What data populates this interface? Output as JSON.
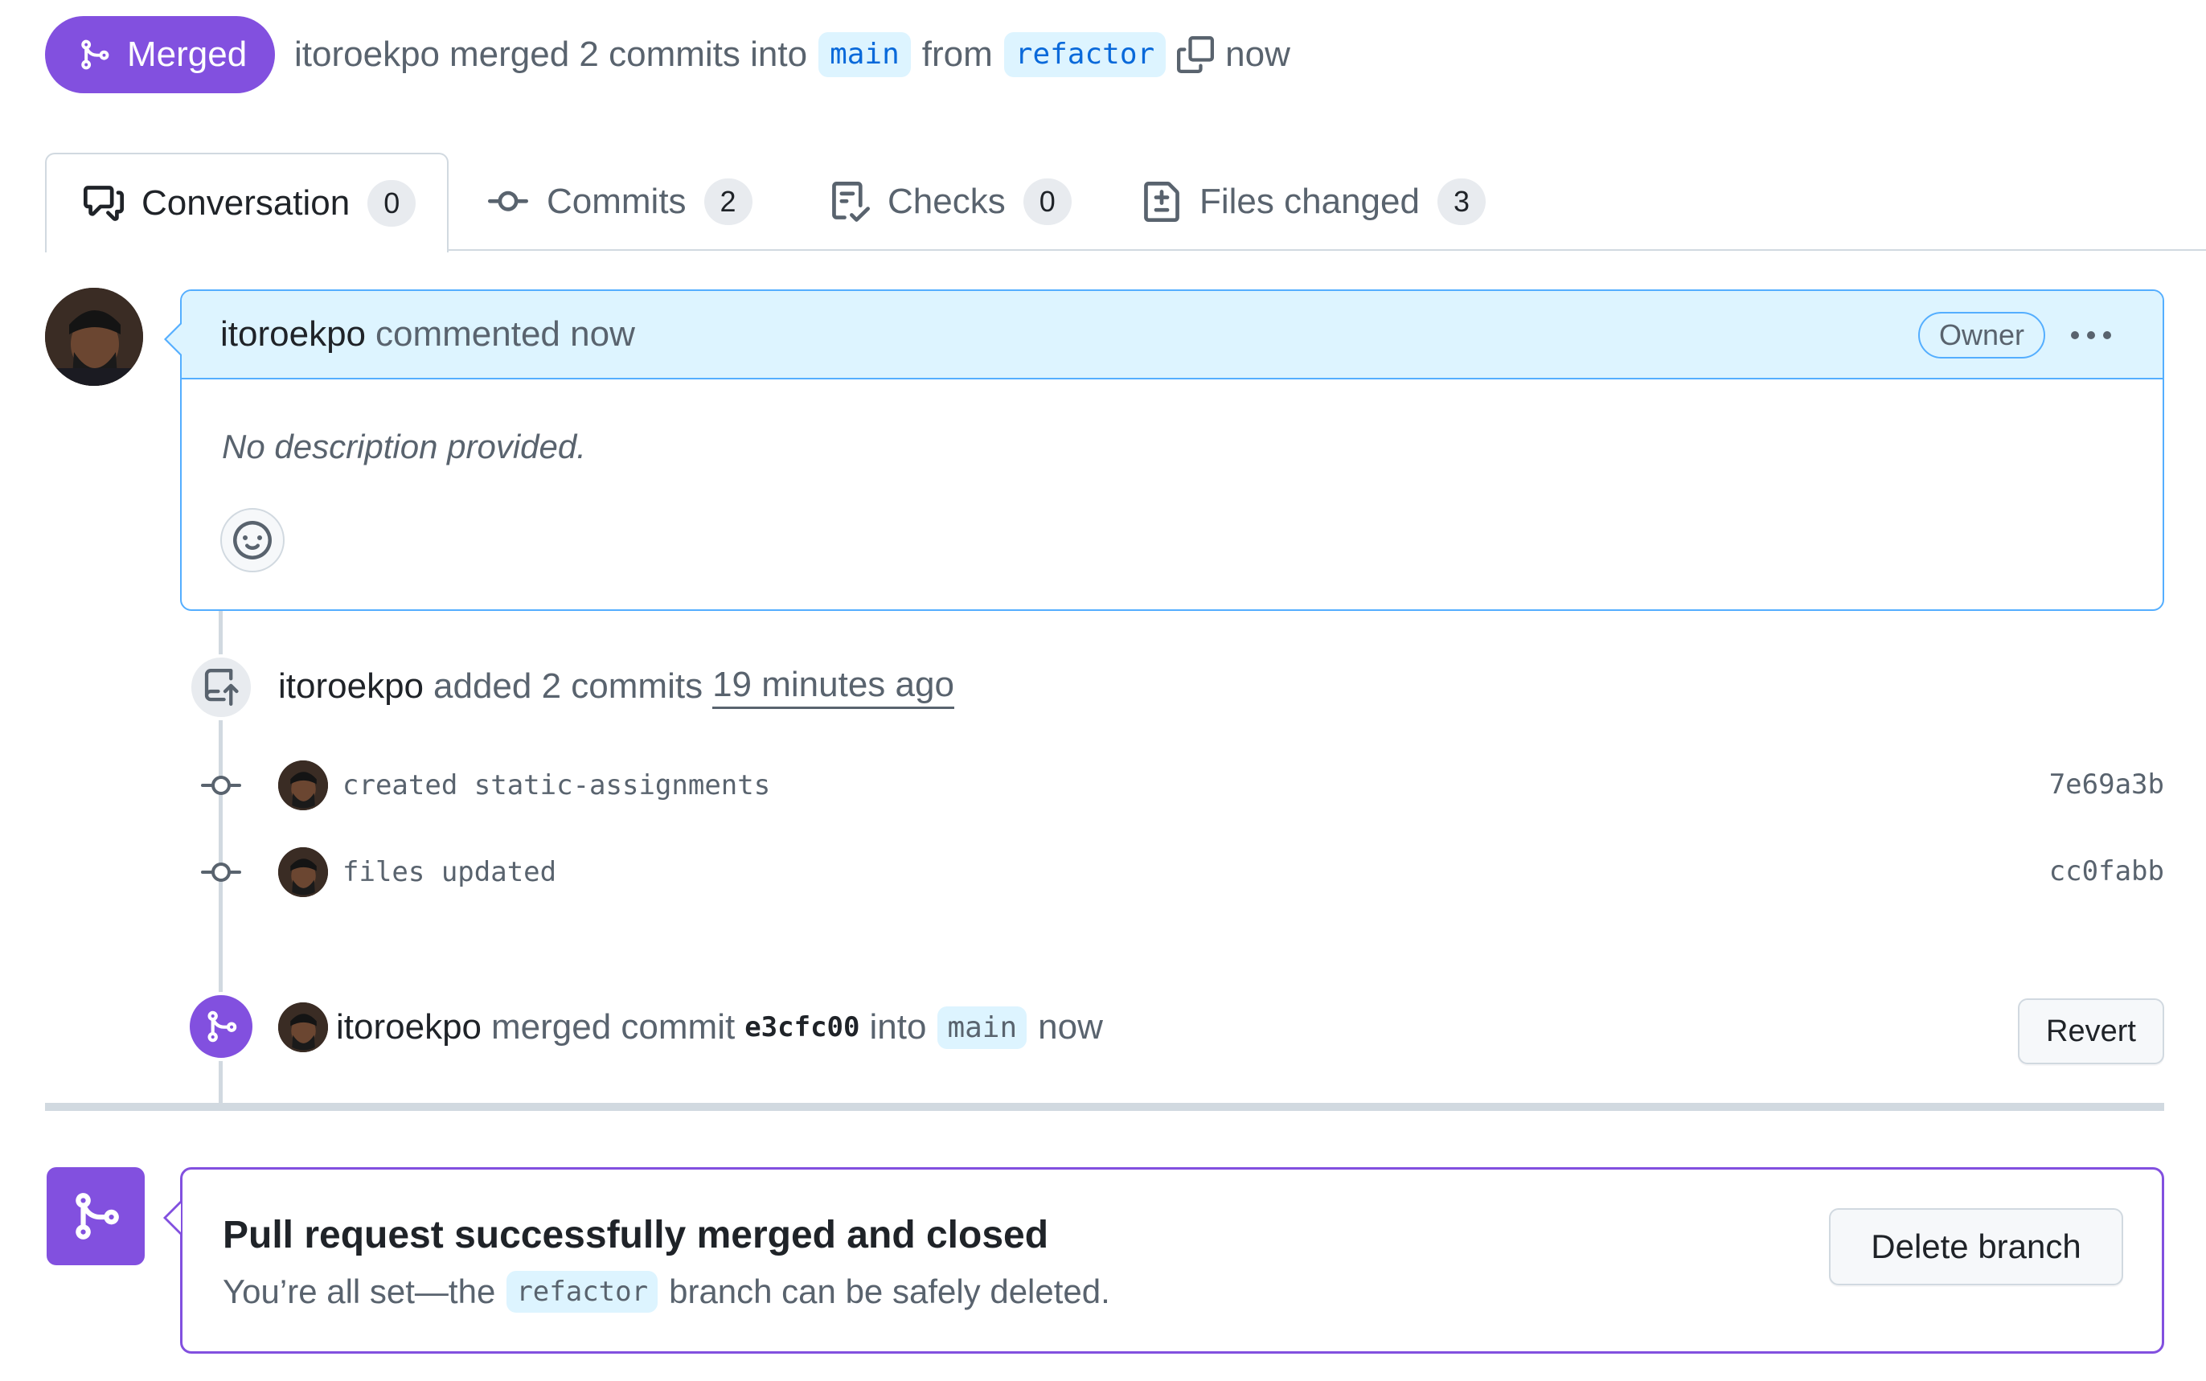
{
  "header": {
    "state_label": "Merged",
    "author": "itoroekpo",
    "merge_text": "merged 2 commits into",
    "base_branch": "main",
    "from_text": "from",
    "head_branch": "refactor",
    "time": "now"
  },
  "tabs": [
    {
      "label": "Conversation",
      "count": "0",
      "icon": "comment-discussion-icon",
      "selected": true
    },
    {
      "label": "Commits",
      "count": "2",
      "icon": "git-commit-icon"
    },
    {
      "label": "Checks",
      "count": "0",
      "icon": "checklist-icon"
    },
    {
      "label": "Files changed",
      "count": "3",
      "icon": "file-diff-icon"
    }
  ],
  "comment": {
    "author": "itoroekpo",
    "action": "commented now",
    "badge": "Owner",
    "body": "No description provided."
  },
  "commits_event": {
    "author": "itoroekpo",
    "action": "added 2 commits",
    "time": "19 minutes ago",
    "commits": [
      {
        "message": "created static-assignments",
        "sha": "7e69a3b"
      },
      {
        "message": "files updated",
        "sha": "cc0fabb"
      }
    ]
  },
  "merge_event": {
    "author": "itoroekpo",
    "action": "merged commit",
    "sha": "e3cfc00",
    "into": "into",
    "branch": "main",
    "time": "now",
    "revert_label": "Revert"
  },
  "merged_box": {
    "title": "Pull request successfully merged and closed",
    "sub_before": "You’re all set—the",
    "branch": "refactor",
    "sub_after": "branch can be safely deleted.",
    "delete_label": "Delete branch"
  },
  "colors": {
    "merged_purple": "#8250df",
    "accent_blue": "#0969da",
    "branch_bg": "#ddf4ff",
    "border": "#d1d9e0"
  }
}
